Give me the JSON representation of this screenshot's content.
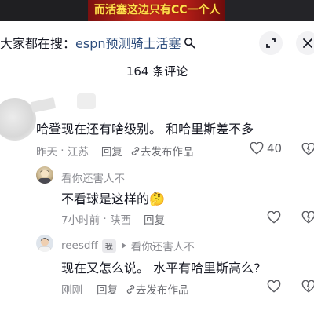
{
  "video_banner": {
    "caption": "而活塞这边只有CC一个人"
  },
  "header": {
    "search_prefix": "大家都在搜：",
    "search_keyword": "espn预测骑士活塞",
    "comment_count_title": "164 条评论"
  },
  "comments": [
    {
      "text": "哈登现在还有啥级别。 和哈里斯差不多",
      "time": "昨天",
      "location": "江苏",
      "reply_label": "回复",
      "post_label": "去发布作品",
      "likes": "40"
    }
  ],
  "replies": [
    {
      "username": "看你还害人不",
      "text": "不看球是这样的🤔",
      "time": "7小时前",
      "location": "陕西",
      "reply_label": "回复"
    },
    {
      "username": "reesdff",
      "author_tag": "我",
      "reply_to": "看你还害人不",
      "text": "现在又怎么说。 水平有哈里斯高么?",
      "time": "刚刚",
      "reply_label": "回复",
      "post_label": "去发布作品"
    }
  ],
  "colors": {
    "keyword_link": "#2c4c7c",
    "secondary_text": "#8a8b91"
  }
}
